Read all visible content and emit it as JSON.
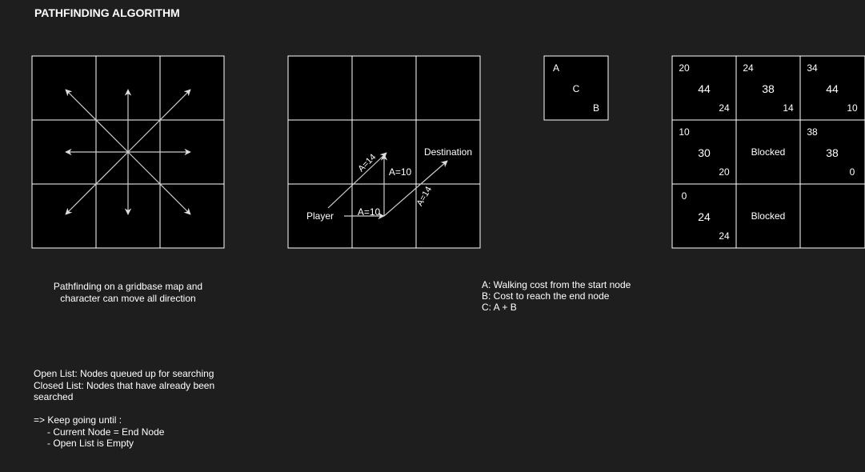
{
  "title": "PATHFINDING ALGORITHM",
  "grid1_caption": [
    "Pathfinding on a gridbase map and",
    "character can move all direction"
  ],
  "grid2": {
    "player": "Player",
    "destination": "Destination",
    "cost_diag_1": "A=14",
    "cost_vertical": "A=10",
    "cost_horizontal": "A=10",
    "cost_diag_2": "A=14"
  },
  "legend_box": {
    "a": "A",
    "c": "C",
    "b": "B"
  },
  "legend_text": [
    "A: Walking cost from the start node",
    "B: Cost to reach the end node",
    "C: A + B"
  ],
  "cost_grid": {
    "cells": [
      {
        "a": "20",
        "c": "44",
        "b": "24"
      },
      {
        "a": "24",
        "c": "38",
        "b": "14"
      },
      {
        "a": "34",
        "c": "44",
        "b": "10"
      },
      {
        "a": "10",
        "c": "30",
        "b": "20"
      },
      {
        "blocked": "Blocked"
      },
      {
        "a": "38",
        "c": "38",
        "b": "0"
      },
      {
        "a": "0",
        "c": "24",
        "b": "24"
      },
      {
        "blocked": "Blocked"
      },
      {}
    ]
  },
  "notes": {
    "open_list": "Open List: Nodes queued up for searching",
    "closed_list_1": "Closed List: Nodes that have already been",
    "closed_list_2": "searched",
    "keep_going": "=> Keep going until :",
    "cond_1": "-  Current Node = End Node",
    "cond_2": "-  Open List is Empty"
  },
  "colors": {
    "background": "#1e1e1e",
    "cell_fill": "#000000",
    "line": "#ffffff",
    "arrow": "#cccccc"
  }
}
